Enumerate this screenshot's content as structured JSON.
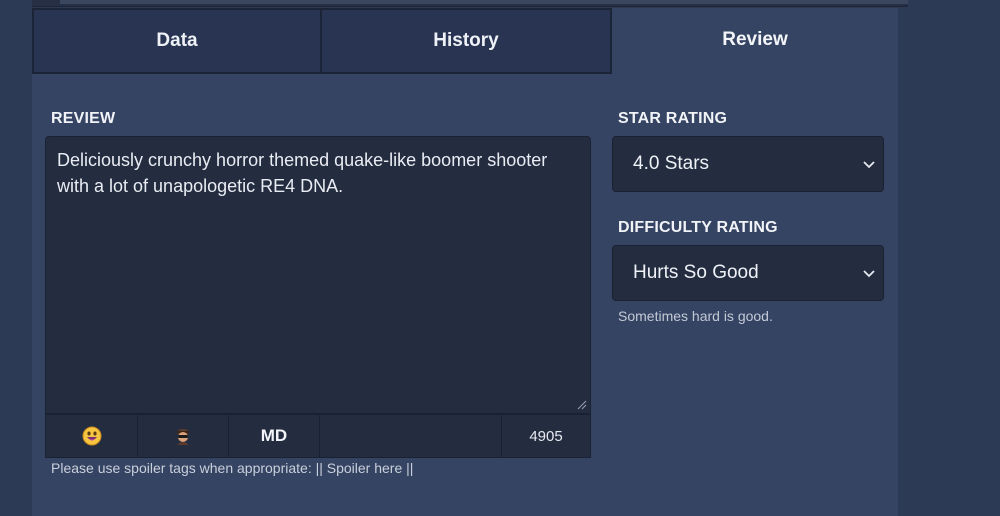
{
  "tabs": [
    {
      "label": "Data",
      "active": false
    },
    {
      "label": "History",
      "active": false
    },
    {
      "label": "Review",
      "active": true
    }
  ],
  "review": {
    "label": "REVIEW",
    "text": "Deliciously crunchy horror themed quake-like boomer shooter with a lot of unapologetic RE4 DNA.",
    "toolbar": {
      "emoji_icon": "grinning-emoji-icon",
      "spoiler_icon": "spoiler-spy-icon",
      "md_label": "MD",
      "char_count": "4905"
    },
    "hint": "Please use spoiler tags when appropriate: || Spoiler here ||"
  },
  "star_rating": {
    "label": "STAR RATING",
    "selected": "4.0 Stars"
  },
  "difficulty_rating": {
    "label": "DIFFICULTY RATING",
    "selected": "Hurts So Good",
    "help": "Sometimes hard is good."
  },
  "colors": {
    "page_bg": "#2c3a56",
    "panel_bg": "#354462",
    "input_bg": "#242c40",
    "tab_inactive_bg": "#283452"
  }
}
